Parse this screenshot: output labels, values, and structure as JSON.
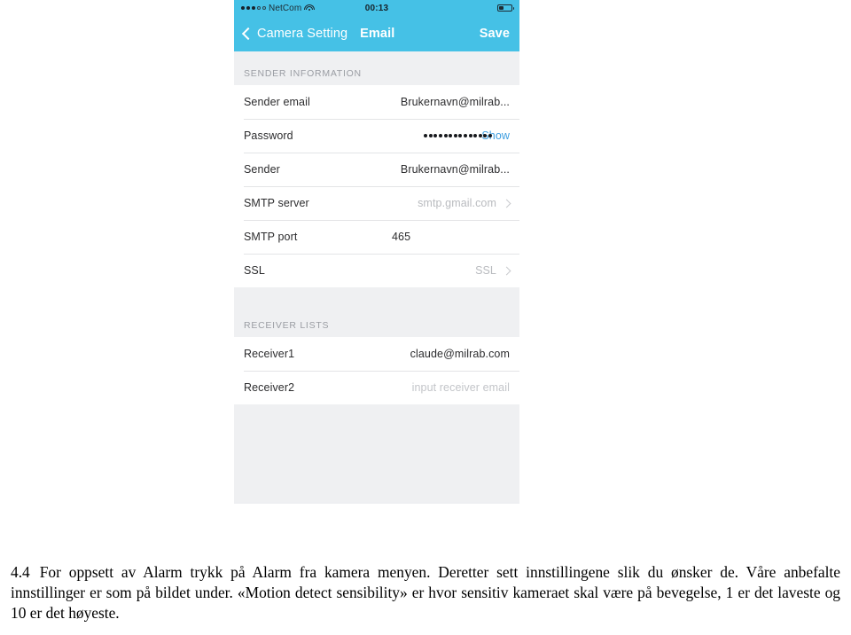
{
  "phone": {
    "status_bar": {
      "signal_dots_filled": 3,
      "signal_dots_hollow": 2,
      "carrier": "NetCom",
      "wifi_icon": "wifi-icon",
      "time": "00:13",
      "battery_icon": "battery-icon",
      "battery_level_percent": 34
    },
    "nav_bar": {
      "back_icon": "chevron-left-icon",
      "back_label": "Camera Setting",
      "title": "Email",
      "save_label": "Save",
      "background_color": "#45c1e6",
      "text_color": "#ffffff"
    },
    "sections": [
      {
        "header": "SENDER INFORMATION",
        "rows": [
          {
            "label": "Sender email",
            "value": "Brukernavn@milrab...",
            "style": "normal",
            "chevron": false
          },
          {
            "label": "Password",
            "value": "Show",
            "style": "password",
            "dots": 14,
            "chevron": false
          },
          {
            "label": "Sender",
            "value": "Brukernavn@milrab...",
            "style": "normal",
            "chevron": false
          },
          {
            "label": "SMTP server",
            "value": "smtp.gmail.com",
            "style": "muted",
            "chevron": true
          },
          {
            "label": "SMTP port",
            "value": "465",
            "style": "port",
            "chevron": false
          },
          {
            "label": "SSL",
            "value": "SSL",
            "style": "muted",
            "chevron": true
          }
        ]
      },
      {
        "header": "RECEIVER LISTS",
        "rows": [
          {
            "label": "Receiver1",
            "value": "claude@milrab.com",
            "style": "normal",
            "chevron": false
          },
          {
            "label": "Receiver2",
            "value": "input receiver email",
            "style": "placeholder",
            "chevron": false
          }
        ]
      }
    ],
    "colors": {
      "accent": "#45c1e6",
      "link": "#3d9ee0",
      "group_background": "#eff0f2",
      "row_background": "#ffffff",
      "label_text": "#2c2c2e",
      "muted_text": "#b9bbbf"
    }
  },
  "document": {
    "number": "4.4",
    "body": "For oppsett av Alarm trykk på Alarm fra kamera menyen. Deretter sett innstillingene slik du ønsker de. Våre anbefalte innstillinger er som på bildet under. «Motion detect sensibility» er hvor sensitiv kameraet skal være på bevegelse, 1 er det laveste og 10 er det høyeste."
  }
}
